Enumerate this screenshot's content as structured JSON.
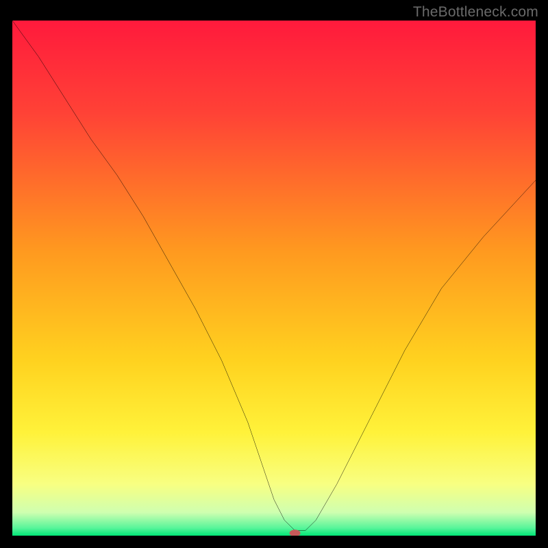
{
  "watermark": "TheBottleneck.com",
  "chart_data": {
    "type": "line",
    "title": "",
    "xlabel": "",
    "ylabel": "",
    "xlim": [
      0,
      100
    ],
    "ylim": [
      0,
      100
    ],
    "grid": false,
    "legend": false,
    "background_gradient": {
      "stops": [
        {
          "pos": 0.0,
          "color": "#ff1a3c"
        },
        {
          "pos": 0.18,
          "color": "#ff4236"
        },
        {
          "pos": 0.45,
          "color": "#ff9a1f"
        },
        {
          "pos": 0.66,
          "color": "#ffd21f"
        },
        {
          "pos": 0.8,
          "color": "#fff23a"
        },
        {
          "pos": 0.9,
          "color": "#f8ff82"
        },
        {
          "pos": 0.955,
          "color": "#cfffb0"
        },
        {
          "pos": 0.985,
          "color": "#58f59a"
        },
        {
          "pos": 1.0,
          "color": "#00e676"
        }
      ]
    },
    "curve": {
      "x": [
        0,
        5,
        10,
        15,
        20,
        25,
        30,
        35,
        40,
        45,
        48,
        50,
        52,
        54,
        56,
        58,
        62,
        68,
        75,
        82,
        90,
        100
      ],
      "y": [
        100,
        93,
        85,
        77,
        70,
        62,
        53,
        44,
        34,
        22,
        13,
        7,
        3,
        1,
        1,
        3,
        10,
        22,
        36,
        48,
        58,
        69
      ]
    },
    "marker": {
      "x": 54,
      "y": 0.5,
      "color": "#c75a5a",
      "rx": 8,
      "ry": 5
    }
  }
}
